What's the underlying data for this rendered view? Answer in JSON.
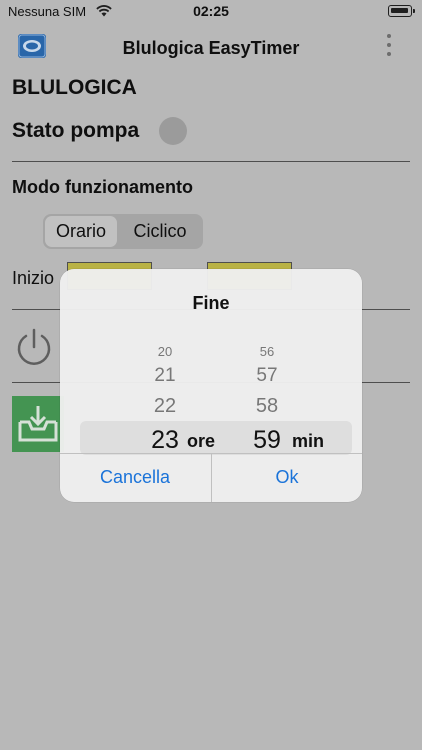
{
  "status_bar": {
    "carrier": "Nessuna SIM",
    "time": "02:25"
  },
  "nav": {
    "title": "Blulogica EasyTimer"
  },
  "main": {
    "brand": "BLULOGICA",
    "pump_state_label": "Stato pompa",
    "mode_label": "Modo funzionamento",
    "mode_options": [
      "Orario",
      "Ciclico"
    ],
    "start_label": "Inizio"
  },
  "picker_dialog": {
    "title": "Fine",
    "hours": [
      "20",
      "21",
      "22",
      "23"
    ],
    "minutes": [
      "56",
      "57",
      "58",
      "59"
    ],
    "hours_unit": "ore",
    "minutes_unit": "min",
    "cancel_label": "Cancella",
    "ok_label": "Ok"
  },
  "colors": {
    "field_yellow": "#c9c24b",
    "accent_blue": "#1a73d9",
    "save_green": "#4aa15a"
  }
}
